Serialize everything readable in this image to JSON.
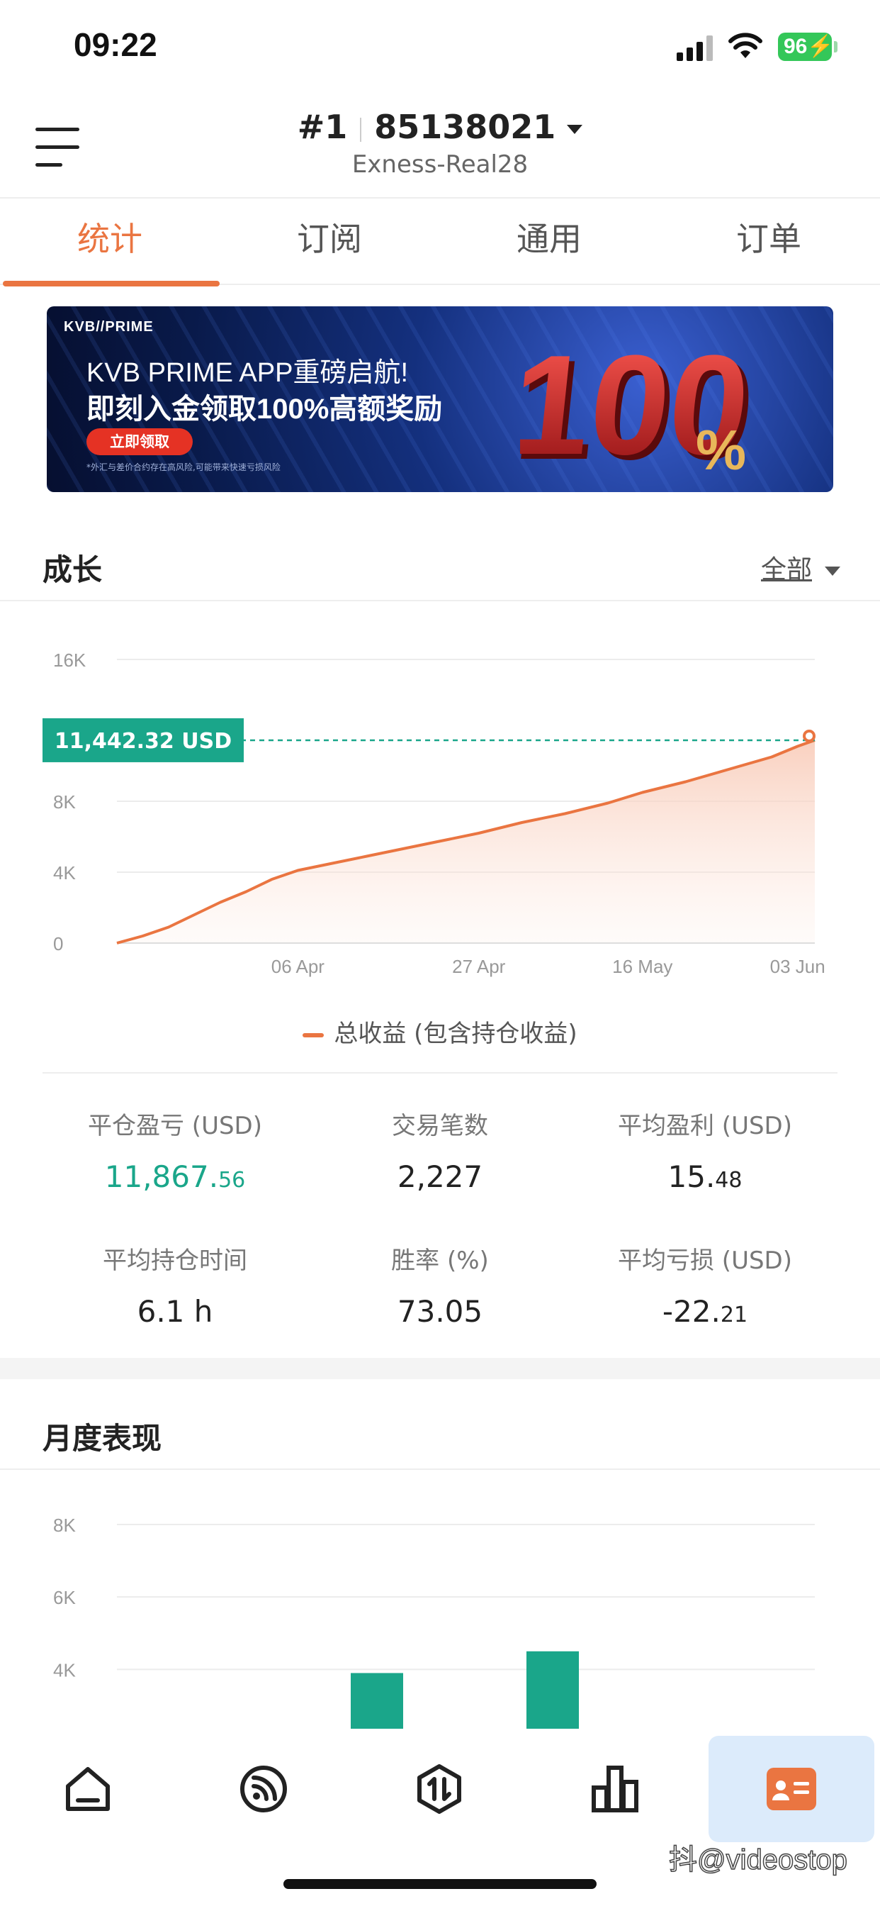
{
  "status_bar": {
    "time": "09:22",
    "battery": "96"
  },
  "header": {
    "account_number": "#1",
    "account_id": "85138021",
    "server": "Exness-Real28"
  },
  "tabs": [
    {
      "label": "统计",
      "active": true
    },
    {
      "label": "订阅",
      "active": false
    },
    {
      "label": "通用",
      "active": false
    },
    {
      "label": "订单",
      "active": false
    }
  ],
  "banner": {
    "brand": "KVB//PRIME",
    "title": "KVB PRIME APP重磅启航!",
    "subtitle": "即刻入金领取100%高额奖励",
    "cta": "立即领取",
    "disclaimer": "*外汇与差价合约存在高风险,可能带来快速亏损风险",
    "big_text": "100%"
  },
  "growth": {
    "title": "成长",
    "filter": "全部",
    "current_value_label": "11,442.32 USD",
    "legend": "总收益 (包含持仓收益)",
    "accent": "#ea7541",
    "marker_color": "#1aa68a"
  },
  "stats": [
    {
      "label": "平仓盈亏 (USD)",
      "value_main": "11,867.",
      "value_small": "56",
      "green": true
    },
    {
      "label": "交易笔数",
      "value_main": "2,227",
      "value_small": ""
    },
    {
      "label": "平均盈利 (USD)",
      "value_main": "15.",
      "value_small": "48"
    },
    {
      "label": "平均持仓时间",
      "value_main": "6.1 h",
      "value_small": ""
    },
    {
      "label": "胜率 (%)",
      "value_main": "73.05",
      "value_small": ""
    },
    {
      "label": "平均亏损 (USD)",
      "value_main": "-22.",
      "value_small": "21"
    }
  ],
  "monthly": {
    "title": "月度表现"
  },
  "nav": [
    {
      "icon": "home-icon"
    },
    {
      "icon": "signals-icon"
    },
    {
      "icon": "trade-icon"
    },
    {
      "icon": "chart-icon"
    },
    {
      "icon": "profile-card-icon",
      "active": true
    }
  ],
  "watermark": "抖@videostop",
  "chart_data": [
    {
      "type": "area",
      "title": "",
      "xlabel": "",
      "ylabel": "",
      "x_ticks": [
        "06 Apr",
        "27 Apr",
        "16 May",
        "03 Jun"
      ],
      "y_ticks": [
        "0",
        "4K",
        "8K",
        "16K"
      ],
      "ylim": [
        0,
        16000
      ],
      "grid": true,
      "x": [
        "2024-03-16",
        "2024-03-19",
        "2024-03-22",
        "2024-03-25",
        "2024-03-28",
        "2024-03-31",
        "2024-04-03",
        "2024-04-06",
        "2024-04-10",
        "2024-04-14",
        "2024-04-18",
        "2024-04-22",
        "2024-04-27",
        "2024-05-02",
        "2024-05-07",
        "2024-05-12",
        "2024-05-16",
        "2024-05-21",
        "2024-05-26",
        "2024-05-31",
        "2024-06-03",
        "2024-06-05"
      ],
      "series": [
        {
          "name": "总收益 (包含持仓收益)",
          "values": [
            0,
            400,
            900,
            1600,
            2300,
            2900,
            3600,
            4100,
            4500,
            4900,
            5300,
            5700,
            6200,
            6800,
            7300,
            7900,
            8500,
            9100,
            9800,
            10500,
            11100,
            11442.32
          ]
        }
      ]
    },
    {
      "type": "bar",
      "title": "",
      "y_ticks": [
        "4K",
        "6K",
        "8K"
      ],
      "ylim": [
        3400,
        8000
      ],
      "grid": true,
      "visible_values": [
        3900,
        4500
      ]
    }
  ]
}
